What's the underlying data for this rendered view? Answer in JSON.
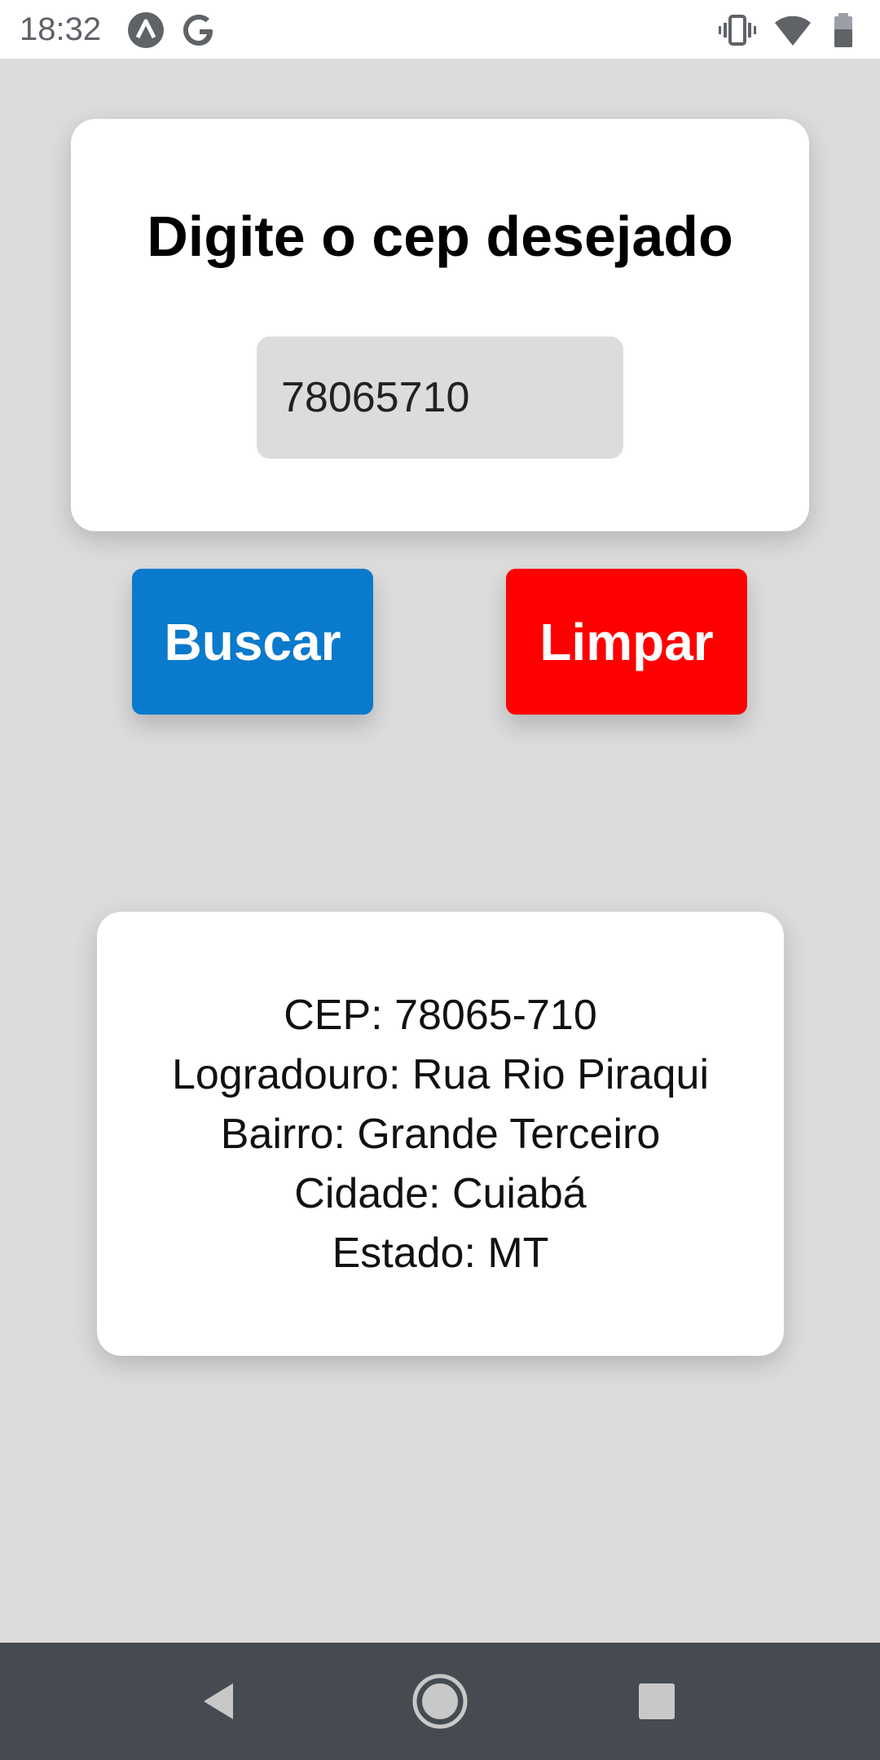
{
  "status_bar": {
    "time": "18:32",
    "left_icons": [
      "app-a-icon",
      "google-icon"
    ],
    "right_icons": [
      "vibrate-icon",
      "wifi-icon",
      "battery-icon"
    ]
  },
  "search_card": {
    "title": "Digite o cep desejado",
    "cep_value": "78065710"
  },
  "buttons": {
    "search_label": "Buscar",
    "search_color": "#0a7acc",
    "clear_label": "Limpar",
    "clear_color": "#ff0000"
  },
  "result": {
    "cep": "CEP: 78065-710",
    "logradouro": "Logradouro: Rua Rio Piraqui",
    "bairro": "Bairro: Grande Terceiro",
    "cidade": "Cidade: Cuiabá",
    "estado": "Estado: MT"
  },
  "nav_bar": {
    "icons": [
      "back-icon",
      "home-icon",
      "recents-icon"
    ]
  }
}
